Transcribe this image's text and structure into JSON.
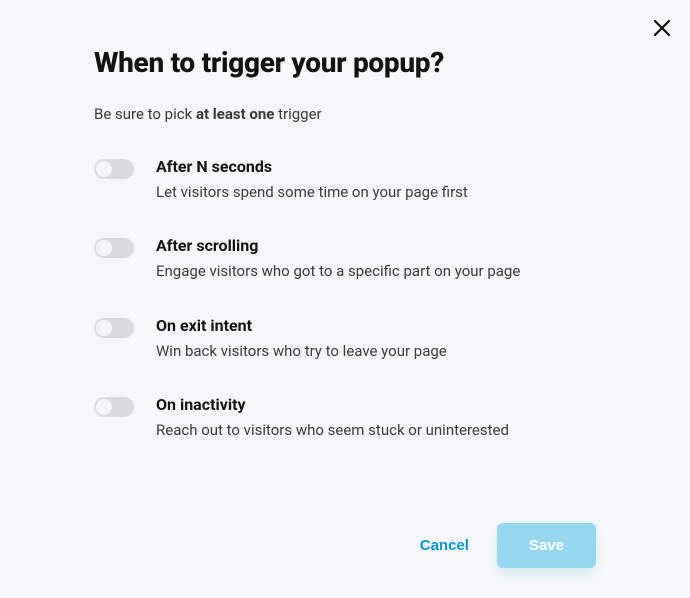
{
  "modal": {
    "title": "When to trigger your popup?",
    "subtitle_pre": "Be sure to pick ",
    "subtitle_bold": "at least one",
    "subtitle_post": " trigger"
  },
  "options": [
    {
      "title": "After N seconds",
      "desc": "Let visitors spend some time on your page first"
    },
    {
      "title": "After scrolling",
      "desc": "Engage visitors who got to a specific part on your page"
    },
    {
      "title": "On exit intent",
      "desc": "Win back visitors who try to leave your page"
    },
    {
      "title": "On inactivity",
      "desc": "Reach out to visitors who seem stuck or uninterested"
    }
  ],
  "footer": {
    "cancel": "Cancel",
    "save": "Save"
  }
}
